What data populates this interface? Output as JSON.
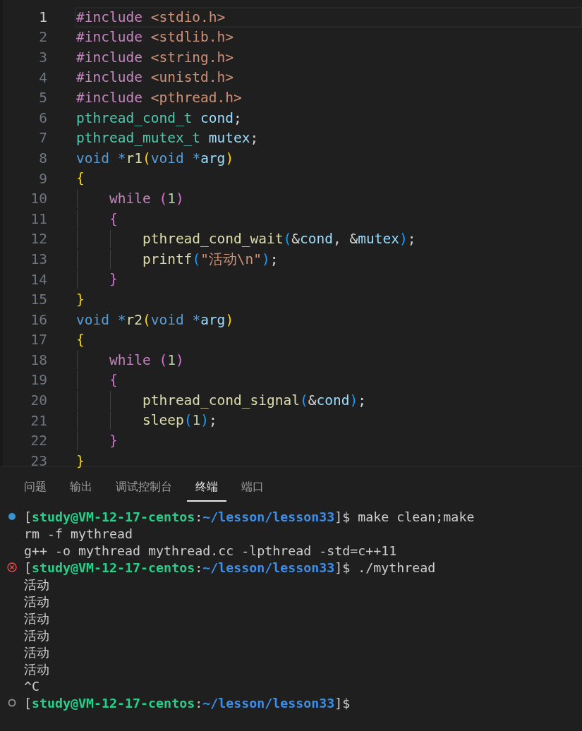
{
  "editor": {
    "lines": [
      {
        "number": "1",
        "selected": true,
        "tokens": [
          {
            "text": "#include ",
            "kind": "keyword"
          },
          {
            "text": "<stdio.h>",
            "kind": "string"
          }
        ]
      },
      {
        "number": "2",
        "selected": false,
        "tokens": [
          {
            "text": "#include ",
            "kind": "keyword"
          },
          {
            "text": "<stdlib.h>",
            "kind": "string"
          }
        ]
      },
      {
        "number": "3",
        "selected": false,
        "tokens": [
          {
            "text": "#include ",
            "kind": "keyword"
          },
          {
            "text": "<string.h>",
            "kind": "string"
          }
        ]
      },
      {
        "number": "4",
        "selected": false,
        "tokens": [
          {
            "text": "#include ",
            "kind": "keyword"
          },
          {
            "text": "<unistd.h>",
            "kind": "string"
          }
        ]
      },
      {
        "number": "5",
        "selected": false,
        "tokens": [
          {
            "text": "#include ",
            "kind": "keyword"
          },
          {
            "text": "<pthread.h>",
            "kind": "string"
          }
        ]
      },
      {
        "number": "6",
        "selected": false,
        "tokens": [
          {
            "text": "pthread_cond_t ",
            "kind": "type"
          },
          {
            "text": "cond",
            "kind": "variable"
          },
          {
            "text": ";",
            "kind": "plain"
          }
        ]
      },
      {
        "number": "7",
        "selected": false,
        "tokens": [
          {
            "text": "pthread_mutex_t ",
            "kind": "type"
          },
          {
            "text": "mutex",
            "kind": "variable"
          },
          {
            "text": ";",
            "kind": "plain"
          }
        ]
      },
      {
        "number": "8",
        "selected": false,
        "tokens": [
          {
            "text": "void ",
            "kind": "storage"
          },
          {
            "text": "*",
            "kind": "storage"
          },
          {
            "text": "r1",
            "kind": "function"
          },
          {
            "text": "(",
            "kind": "bracket1"
          },
          {
            "text": "void ",
            "kind": "storage"
          },
          {
            "text": "*",
            "kind": "storage"
          },
          {
            "text": "arg",
            "kind": "variable"
          },
          {
            "text": ")",
            "kind": "bracket1"
          }
        ]
      },
      {
        "number": "9",
        "selected": false,
        "tokens": [
          {
            "text": "{",
            "kind": "bracket1"
          }
        ]
      },
      {
        "number": "10",
        "selected": false,
        "tokens": [
          {
            "text": "    while ",
            "kind": "keyword"
          },
          {
            "text": "(",
            "kind": "bracket2"
          },
          {
            "text": "1",
            "kind": "number"
          },
          {
            "text": ")",
            "kind": "bracket2"
          }
        ]
      },
      {
        "number": "11",
        "selected": false,
        "tokens": [
          {
            "text": "    {",
            "kind": "bracket2"
          }
        ]
      },
      {
        "number": "12",
        "selected": false,
        "tokens": [
          {
            "text": "        pthread_cond_wait",
            "kind": "function"
          },
          {
            "text": "(",
            "kind": "bracket3"
          },
          {
            "text": "&",
            "kind": "plain"
          },
          {
            "text": "cond",
            "kind": "variable"
          },
          {
            "text": ", ",
            "kind": "plain"
          },
          {
            "text": "&",
            "kind": "plain"
          },
          {
            "text": "mutex",
            "kind": "variable"
          },
          {
            "text": ")",
            "kind": "bracket3"
          },
          {
            "text": ";",
            "kind": "plain"
          }
        ]
      },
      {
        "number": "13",
        "selected": false,
        "tokens": [
          {
            "text": "        printf",
            "kind": "function"
          },
          {
            "text": "(",
            "kind": "bracket3"
          },
          {
            "text": "\"活动\\n\"",
            "kind": "string"
          },
          {
            "text": ")",
            "kind": "bracket3"
          },
          {
            "text": ";",
            "kind": "plain"
          }
        ]
      },
      {
        "number": "14",
        "selected": false,
        "tokens": [
          {
            "text": "    }",
            "kind": "bracket2"
          }
        ]
      },
      {
        "number": "15",
        "selected": false,
        "tokens": [
          {
            "text": "}",
            "kind": "bracket1"
          }
        ]
      },
      {
        "number": "16",
        "selected": false,
        "tokens": [
          {
            "text": "void ",
            "kind": "storage"
          },
          {
            "text": "*",
            "kind": "storage"
          },
          {
            "text": "r2",
            "kind": "function"
          },
          {
            "text": "(",
            "kind": "bracket1"
          },
          {
            "text": "void ",
            "kind": "storage"
          },
          {
            "text": "*",
            "kind": "storage"
          },
          {
            "text": "arg",
            "kind": "variable"
          },
          {
            "text": ")",
            "kind": "bracket1"
          }
        ]
      },
      {
        "number": "17",
        "selected": false,
        "tokens": [
          {
            "text": "{",
            "kind": "bracket1"
          }
        ]
      },
      {
        "number": "18",
        "selected": false,
        "tokens": [
          {
            "text": "    while ",
            "kind": "keyword"
          },
          {
            "text": "(",
            "kind": "bracket2"
          },
          {
            "text": "1",
            "kind": "number"
          },
          {
            "text": ")",
            "kind": "bracket2"
          }
        ]
      },
      {
        "number": "19",
        "selected": false,
        "tokens": [
          {
            "text": "    {",
            "kind": "bracket2"
          }
        ]
      },
      {
        "number": "20",
        "selected": false,
        "tokens": [
          {
            "text": "        pthread_cond_signal",
            "kind": "function"
          },
          {
            "text": "(",
            "kind": "bracket3"
          },
          {
            "text": "&",
            "kind": "plain"
          },
          {
            "text": "cond",
            "kind": "variable"
          },
          {
            "text": ")",
            "kind": "bracket3"
          },
          {
            "text": ";",
            "kind": "plain"
          }
        ]
      },
      {
        "number": "21",
        "selected": false,
        "tokens": [
          {
            "text": "        sleep",
            "kind": "function"
          },
          {
            "text": "(",
            "kind": "bracket3"
          },
          {
            "text": "1",
            "kind": "number"
          },
          {
            "text": ")",
            "kind": "bracket3"
          },
          {
            "text": ";",
            "kind": "plain"
          }
        ]
      },
      {
        "number": "22",
        "selected": false,
        "tokens": [
          {
            "text": "    }",
            "kind": "bracket2"
          }
        ]
      },
      {
        "number": "23",
        "selected": false,
        "tokens": [
          {
            "text": "}",
            "kind": "bracket1"
          }
        ]
      }
    ]
  },
  "panel": {
    "tabs": [
      {
        "label": "问题",
        "selected": false
      },
      {
        "label": "输出",
        "selected": false
      },
      {
        "label": "调试控制台",
        "selected": false
      },
      {
        "label": "终端",
        "selected": true
      },
      {
        "label": "端口",
        "selected": false
      }
    ],
    "terminal": {
      "lines": [
        {
          "kind": "success",
          "tokens": [
            {
              "text": "[",
              "kind": "plain"
            },
            {
              "text": "study@VM-12-17-centos",
              "kind": "user"
            },
            {
              "text": ":",
              "kind": "plain"
            },
            {
              "text": "~/lesson/lesson33",
              "kind": "path"
            },
            {
              "text": "]$ make clean;make",
              "kind": "plain"
            }
          ]
        },
        {
          "kind": "output",
          "tokens": [
            {
              "text": "rm -f mythread",
              "kind": "plain"
            }
          ]
        },
        {
          "kind": "output",
          "tokens": [
            {
              "text": "g++ -o mythread mythread.cc -lpthread -std=c++11",
              "kind": "plain"
            }
          ]
        },
        {
          "kind": "error",
          "tokens": [
            {
              "text": "[",
              "kind": "plain"
            },
            {
              "text": "study@VM-12-17-centos",
              "kind": "user"
            },
            {
              "text": ":",
              "kind": "plain"
            },
            {
              "text": "~/lesson/lesson33",
              "kind": "path"
            },
            {
              "text": "]$ ./mythread",
              "kind": "plain"
            }
          ]
        },
        {
          "kind": "output",
          "tokens": [
            {
              "text": "活动",
              "kind": "plain"
            }
          ]
        },
        {
          "kind": "output",
          "tokens": [
            {
              "text": "活动",
              "kind": "plain"
            }
          ]
        },
        {
          "kind": "output",
          "tokens": [
            {
              "text": "活动",
              "kind": "plain"
            }
          ]
        },
        {
          "kind": "output",
          "tokens": [
            {
              "text": "活动",
              "kind": "plain"
            }
          ]
        },
        {
          "kind": "output",
          "tokens": [
            {
              "text": "活动",
              "kind": "plain"
            }
          ]
        },
        {
          "kind": "output",
          "tokens": [
            {
              "text": "活动",
              "kind": "plain"
            }
          ]
        },
        {
          "kind": "output",
          "tokens": [
            {
              "text": "^C",
              "kind": "plain"
            }
          ]
        },
        {
          "kind": "idle",
          "tokens": [
            {
              "text": "[",
              "kind": "plain"
            },
            {
              "text": "study@VM-12-17-centos",
              "kind": "user"
            },
            {
              "text": ":",
              "kind": "plain"
            },
            {
              "text": "~/lesson/lesson33",
              "kind": "path"
            },
            {
              "text": "]$",
              "kind": "plain"
            }
          ]
        }
      ]
    }
  }
}
